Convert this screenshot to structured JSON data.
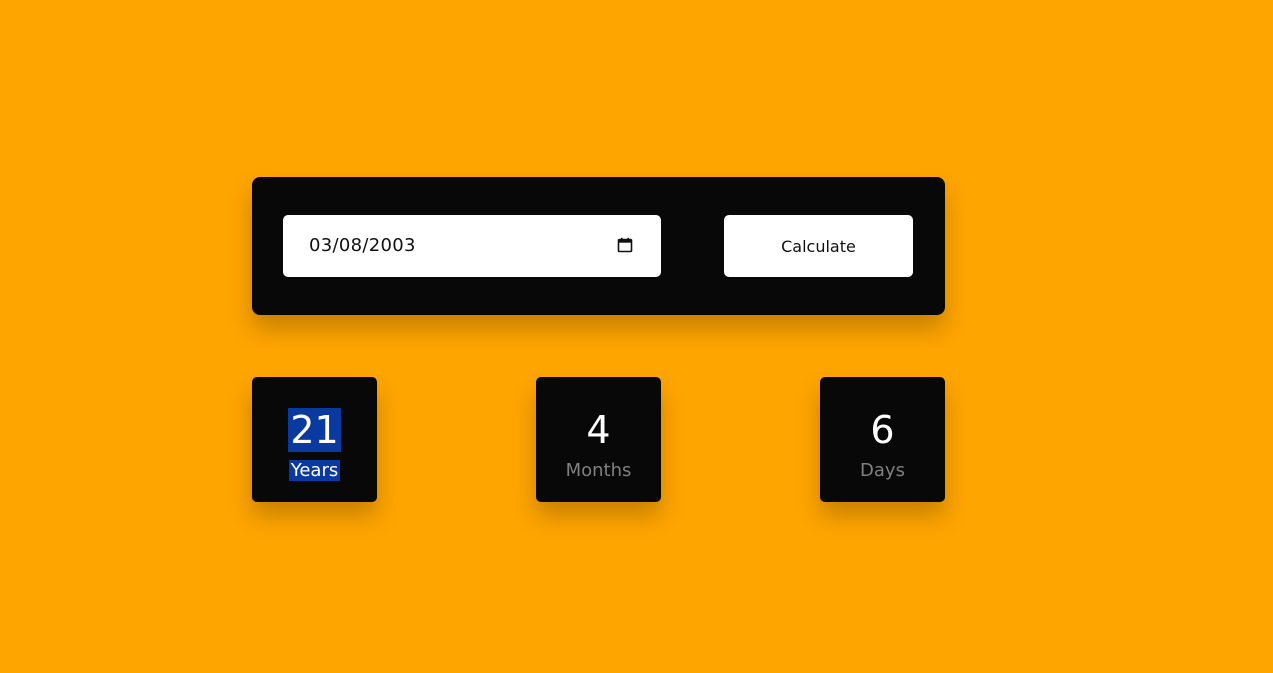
{
  "calculator": {
    "date_value": "03/08/2003",
    "calculate_label": "Calculate"
  },
  "results": {
    "years": {
      "value": "21",
      "label": "Years"
    },
    "months": {
      "value": "4",
      "label": "Months"
    },
    "days": {
      "value": "6",
      "label": "Days"
    }
  },
  "colors": {
    "background": "#ffa500",
    "card": "#080808",
    "selection": "#0a3a9f",
    "muted_label": "#808080"
  },
  "icons": {
    "date_picker": "calendar-icon"
  }
}
